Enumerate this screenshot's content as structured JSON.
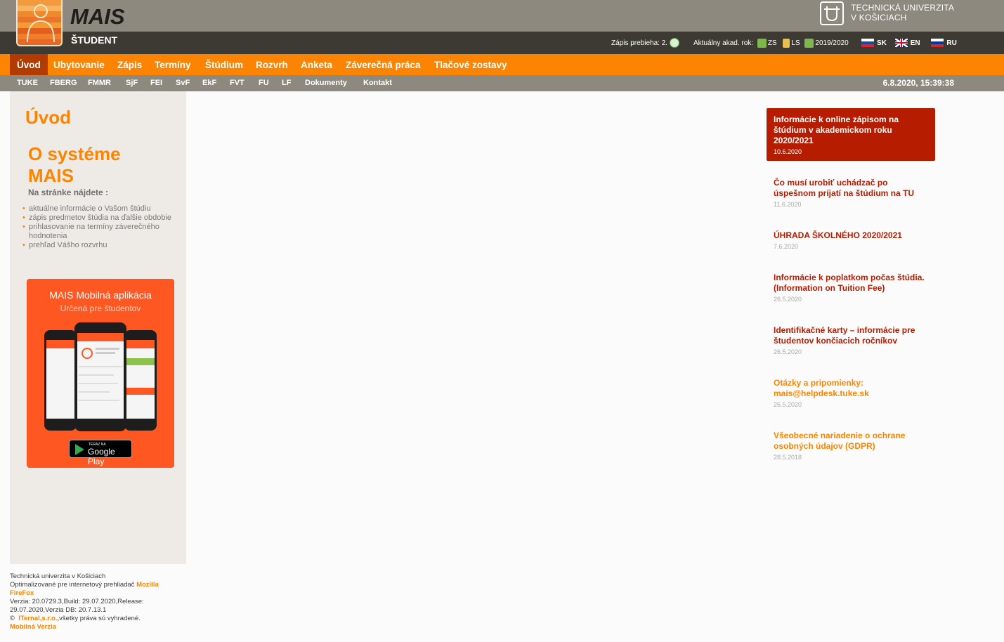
{
  "header": {
    "app_title": "MAIS",
    "app_subtitle": "ŠTUDENT",
    "university_line1": "TECHNICKÁ UNIVERZITA",
    "university_line2": "V KOŠICIACH",
    "enrollment_label": "Zápis prebieha: 2.",
    "academic_year_label": "Aktuálny akad. rok:",
    "semester_winter": "ZS",
    "semester_summer": "LS",
    "academic_year": "2019/2020",
    "languages": [
      "SK",
      "EN",
      "RU"
    ]
  },
  "nav": {
    "items": [
      "Úvod",
      "Ubytovanie",
      "Zápis",
      "Termíny",
      "Štúdium",
      "Rozvrh",
      "Anketa",
      "Záverečná práca",
      "Tlačové zostavy"
    ],
    "active": "Úvod"
  },
  "subnav": {
    "items": [
      "TUKE",
      "FBERG",
      "FMMR",
      "SjF",
      "FEI",
      "SvF",
      "EkF",
      "FVT",
      "FU",
      "LF",
      "Dokumenty",
      "Kontakt"
    ],
    "datetime": "6.8.2020,  15:39:38"
  },
  "left": {
    "heading": "Úvod",
    "about_title": "O systéme MAIS",
    "find_label": "Na stránke nájdete :",
    "bullets": [
      "aktuálne informácie o Vašom štúdiu",
      "zápis predmetov štúdia na ďalšie obdobie",
      "prihlasovanie na termíny záverečného hodnotenia",
      "prehľad Vášho rozvrhu"
    ],
    "mobile_title": "MAIS Mobilná aplikácia",
    "mobile_subtitle": "Určená pre študentov",
    "gplay_small": "TERAZ NA",
    "gplay_big": "Google Play"
  },
  "footer": {
    "line1": "Technická univerzita v Košiciach",
    "line2": "Optimalizované pre internetový prehliadač",
    "browser": "Mozilla FireFox",
    "version": "Verzia: 20.0729.3,Build: 29.07.2020,Release: 29.07.2020,Verzia DB: 20.7.13.1",
    "copyright_prefix": "©",
    "company": "ITernal,s.r.o.",
    "rights": ",všetky práva sú vyhradené.",
    "mobile_link": "Mobilná Verzia"
  },
  "news": [
    {
      "title": "Informácie k online zápisom na štúdium v akademickom roku 2020/2021",
      "date": "10.6.2020",
      "style": "featured"
    },
    {
      "title": "Čo musí urobiť uchádzač po úspešnom prijatí na štúdium na TU",
      "date": "11.6.2020",
      "style": "red"
    },
    {
      "title": "ÚHRADA ŠKOLNÉHO 2020/2021",
      "date": "7.6.2020",
      "style": "red"
    },
    {
      "title": "Informácie k poplatkom počas štúdia. (Information on Tuition Fee)",
      "date": "26.5.2020",
      "style": "red"
    },
    {
      "title": "Identifikačné karty – informácie pre študentov končiacich ročníkov",
      "date": "26.5.2020",
      "style": "red"
    },
    {
      "title": "Otázky a pripomienky: mais@helpdesk.tuke.sk",
      "date": "26.5.2020",
      "style": "orange"
    },
    {
      "title": "Všeobecné nariadenie o ochrane osobných údajov (GDPR)",
      "date": "28.5.2018",
      "style": "orange"
    }
  ],
  "colors": {
    "orange": "#fd8400",
    "dark_red": "#b51c00",
    "header_gray": "#8d897e",
    "header_dark": "#3d3a33",
    "mobile_orange": "#ff5722"
  }
}
